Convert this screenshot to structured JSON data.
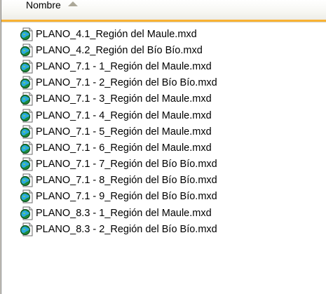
{
  "header": {
    "column_name": "Nombre",
    "sort_icon": "sort-ascending-icon"
  },
  "file_icon": "arcmap-document-icon",
  "files": [
    {
      "name": "PLANO_4.1_Región del Maule.mxd"
    },
    {
      "name": "PLANO_4.2_Región del Bío Bío.mxd"
    },
    {
      "name": "PLANO_7.1 - 1_Región del Maule.mxd"
    },
    {
      "name": "PLANO_7.1 - 2_Región del Bío Bío.mxd"
    },
    {
      "name": "PLANO_7.1 - 3_Región del Maule.mxd"
    },
    {
      "name": "PLANO_7.1 - 4_Región del Maule.mxd"
    },
    {
      "name": "PLANO_7.1 - 5_Región del Maule.mxd"
    },
    {
      "name": "PLANO_7.1 - 6_Región del Maule.mxd"
    },
    {
      "name": "PLANO_7.1 - 7_Región del Bío Bío.mxd"
    },
    {
      "name": "PLANO_7.1 - 8_Región del Bío Bío.mxd"
    },
    {
      "name": "PLANO_7.1 - 9_Región del Bío Bío.mxd"
    },
    {
      "name": "PLANO_8.3 - 1_Región del Maule.mxd"
    },
    {
      "name": "PLANO_8.3 - 2_Región del Bío Bío.mxd"
    }
  ]
}
